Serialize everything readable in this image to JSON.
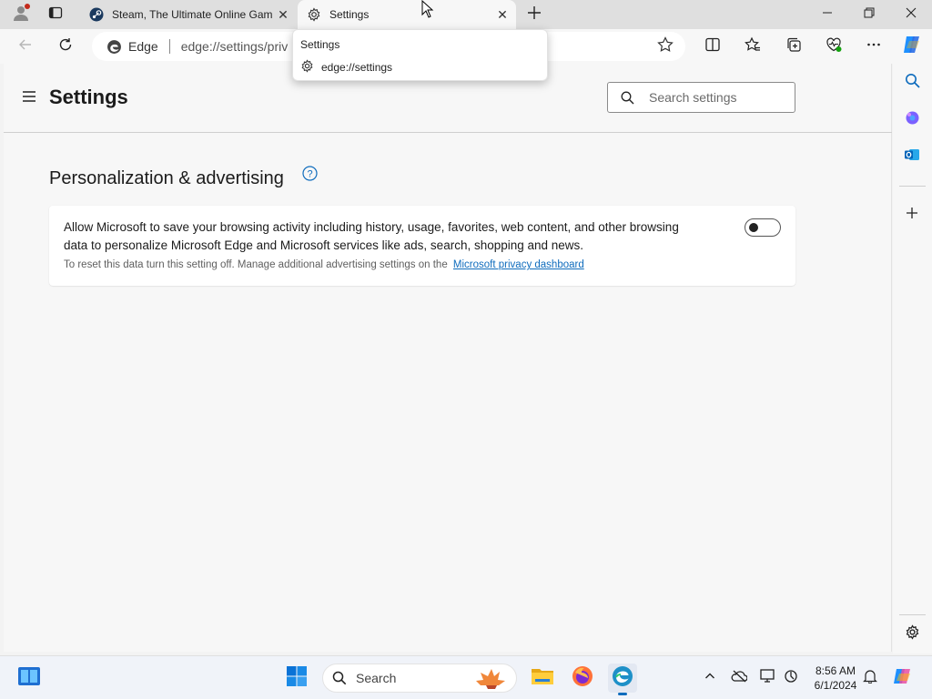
{
  "tabs": [
    {
      "title": "Steam, The Ultimate Online Gam",
      "active": false
    },
    {
      "title": "Settings",
      "active": true
    }
  ],
  "address": {
    "site_label": "Edge",
    "url": "edge://settings/priv"
  },
  "tab_dropdown": {
    "title": "Settings",
    "url": "edge://settings"
  },
  "settings": {
    "page_title": "Settings",
    "search_placeholder": "Search settings",
    "section_title": "Personalization & advertising",
    "card": {
      "main_text_line1": "Allow Microsoft to save your browsing activity including history, usage, favorites, web content, and other browsing",
      "main_text_line2": "data to personalize Microsoft Edge and Microsoft services like ads, search, shopping and news.",
      "sub_text": "To reset this data turn this setting off. Manage additional advertising settings on the",
      "link_text": "Microsoft privacy dashboard",
      "toggle_on": false
    }
  },
  "taskbar": {
    "search_label": "Search",
    "time": "8:56 AM",
    "date": "6/1/2024"
  },
  "colors": {
    "link": "#0f6cbd",
    "accent": "#0078d4",
    "edge_blue": "#1e90c8"
  },
  "icons": [
    "profile-icon",
    "tab-actions-icon",
    "steam-icon",
    "gear-icon",
    "close-icon",
    "new-tab-icon",
    "minimize-icon",
    "restore-icon",
    "back-icon",
    "refresh-icon",
    "edge-icon",
    "favorite-star-icon",
    "split-screen-icon",
    "favorites-icon",
    "collections-icon",
    "browser-essentials-icon",
    "more-icon",
    "copilot-icon",
    "hamburger-icon",
    "search-icon",
    "help-icon",
    "add-icon",
    "outlook-icon",
    "windows-start-icon",
    "file-explorer-icon",
    "firefox-icon",
    "edge-taskbar-icon",
    "chevron-up-icon",
    "onedrive-icon",
    "network-icon",
    "battery-icon",
    "bell-icon"
  ]
}
